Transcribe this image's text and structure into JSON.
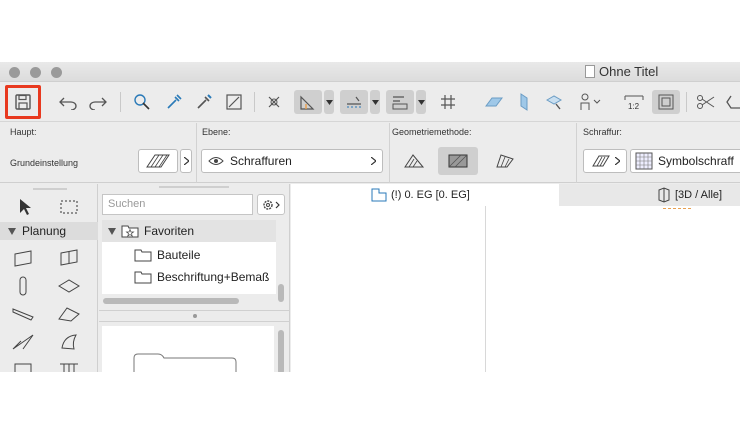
{
  "window": {
    "title": "Ohne Titel"
  },
  "toolbar": {
    "buttons": [
      "save-icon",
      "undo-icon",
      "redo-icon",
      "pick-icon",
      "eyedropper-icon",
      "inject-icon",
      "fit-icon",
      "cursor-snap-icon",
      "guide-icon",
      "tracker-icon",
      "gravity-icon",
      "grid-icon",
      "parallel-icon",
      "perpendicular-icon",
      "magic-wand-icon",
      "figure-icon",
      "scale-icon",
      "layout-icon",
      "scissors-icon",
      "trim-icon"
    ]
  },
  "infobox": {
    "haupt_label": "Haupt:",
    "grundeinstellung": "Grundeinstellung",
    "ebene_label": "Ebene:",
    "ebene_value": "Schraffuren",
    "geometrie_label": "Geometriemethode:",
    "schraffur_label": "Schraffur:",
    "schraffur_value": "Symbolschraff"
  },
  "toolbox": {
    "planung": "Planung"
  },
  "navigator": {
    "search_placeholder": "Suchen",
    "items": [
      {
        "label": "Favoriten"
      },
      {
        "label": "Bauteile"
      },
      {
        "label": "Beschriftung+Bemaß"
      }
    ]
  },
  "tabs": {
    "floor": "(!) 0. EG [0. EG]",
    "view3d": "[3D / Alle]"
  },
  "colors": {
    "highlight": "#e8391f",
    "accent_orange": "#e8a050"
  }
}
